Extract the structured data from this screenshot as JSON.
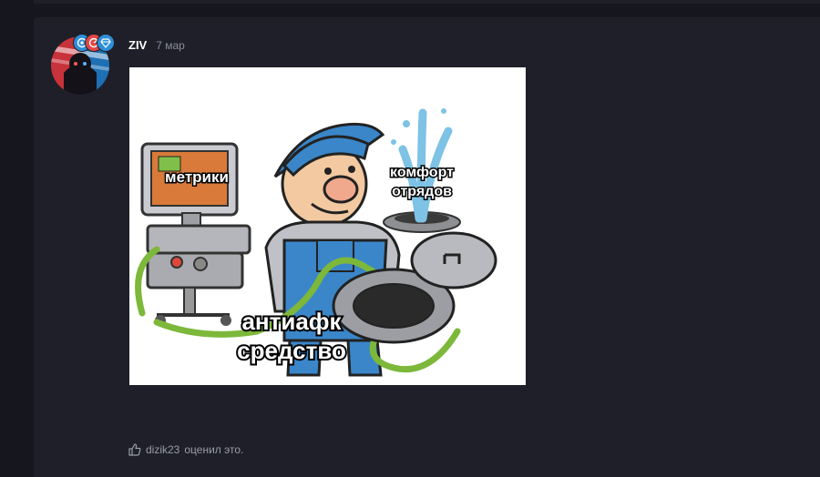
{
  "post": {
    "author": "ZIV",
    "date": "7 мар",
    "image": {
      "caption_metrics": "метрики",
      "caption_comfort_line1": "комфорт",
      "caption_comfort_line2": "отрядов",
      "caption_antiafk_line1": "антиафк",
      "caption_antiafk_line2": "средство"
    },
    "reactions": {
      "icon": "thumbs-up-icon",
      "user": "dizik23",
      "text": "оценил это."
    },
    "badges": [
      "target-badge-icon",
      "radar-badge-icon",
      "diamond-badge-icon"
    ]
  },
  "colors": {
    "page_bg": "#15161e",
    "card_bg": "#1e1f28",
    "accent_blue": "#2e8fd8",
    "accent_red": "#e04646",
    "muted_text": "#8a8d9a"
  }
}
